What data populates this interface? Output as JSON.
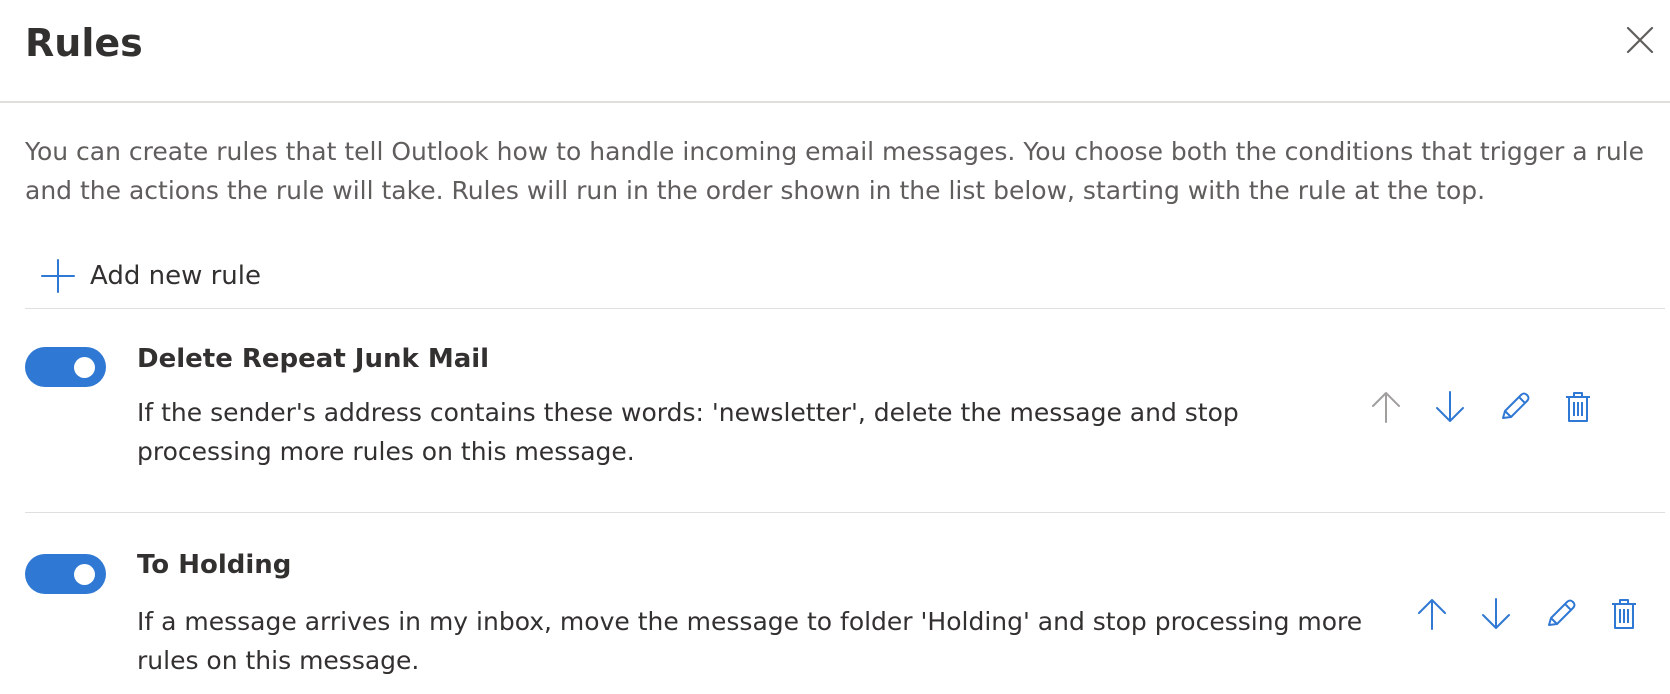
{
  "header": {
    "title": "Rules",
    "close_icon": "close-icon"
  },
  "description": "You can create rules that tell Outlook how to handle incoming email messages. You choose both the conditions that trigger a rule and the actions the rule will take. Rules will run in the order shown in the list below, starting with the rule at the top.",
  "add_rule": {
    "label": "Add new rule",
    "icon": "plus-icon"
  },
  "colors": {
    "accent": "#2f78d4",
    "disabled_icon": "#a19f9d",
    "text": "#323130",
    "secondary_text": "#605e5c",
    "divider": "#e1dfdd"
  },
  "rules": [
    {
      "name": "Delete Repeat Junk Mail",
      "description": "If the sender's address contains these words: 'newsletter', delete the message and stop processing more rules on this message.",
      "enabled": true,
      "actions": [
        "move-up-icon (disabled)",
        "move-down-icon",
        "edit-pencil-icon",
        "delete-trash-icon"
      ]
    },
    {
      "name": "To Holding",
      "description": "If a message arrives in my inbox, move the message to folder 'Holding' and stop processing more rules on this message.",
      "enabled": true,
      "actions": [
        "move-up-icon",
        "move-down-icon",
        "edit-pencil-icon",
        "delete-trash-icon"
      ]
    }
  ]
}
